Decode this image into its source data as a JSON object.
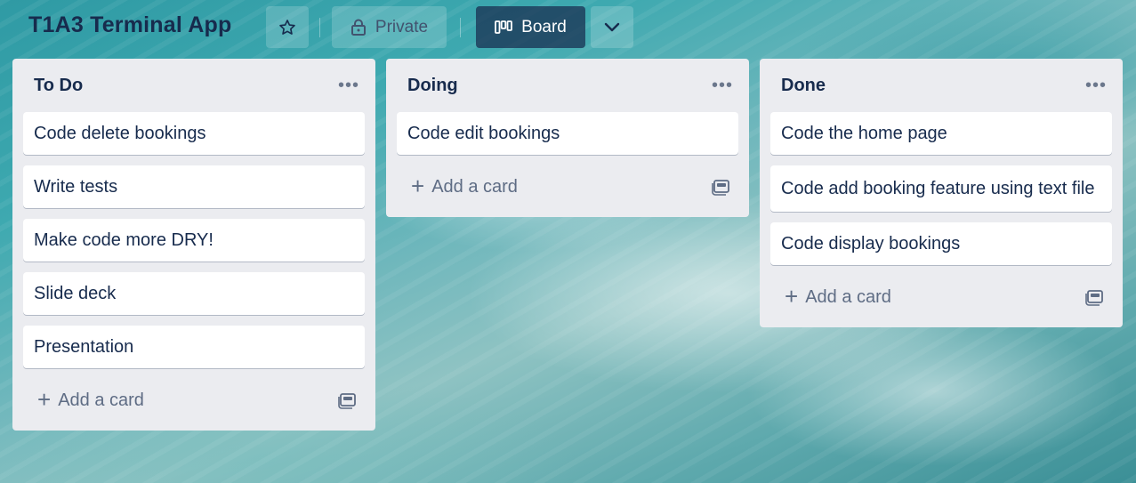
{
  "header": {
    "board_title": "T1A3 Terminal App",
    "private_label": "Private",
    "board_view_label": "Board"
  },
  "icons": {
    "star": "star-icon",
    "lock": "lock-icon",
    "board": "board-icon",
    "chevron": "chevron-down-icon",
    "menu": "ellipsis-icon",
    "plus": "plus-icon",
    "template": "template-icon"
  },
  "lists": [
    {
      "title": "To Do",
      "cards": [
        "Code delete bookings",
        "Write tests",
        "Make code more DRY!",
        "Slide deck",
        "Presentation"
      ],
      "add_label": "Add a card"
    },
    {
      "title": "Doing",
      "cards": [
        "Code edit bookings"
      ],
      "add_label": "Add a card"
    },
    {
      "title": "Done",
      "cards": [
        "Code the home page",
        "Code add booking feature using text file",
        "Code display bookings"
      ],
      "add_label": "Add a card"
    }
  ],
  "colors": {
    "list_bg": "#ebecf0",
    "text": "#172b4d",
    "board_button_bg": "#2c3e50"
  }
}
